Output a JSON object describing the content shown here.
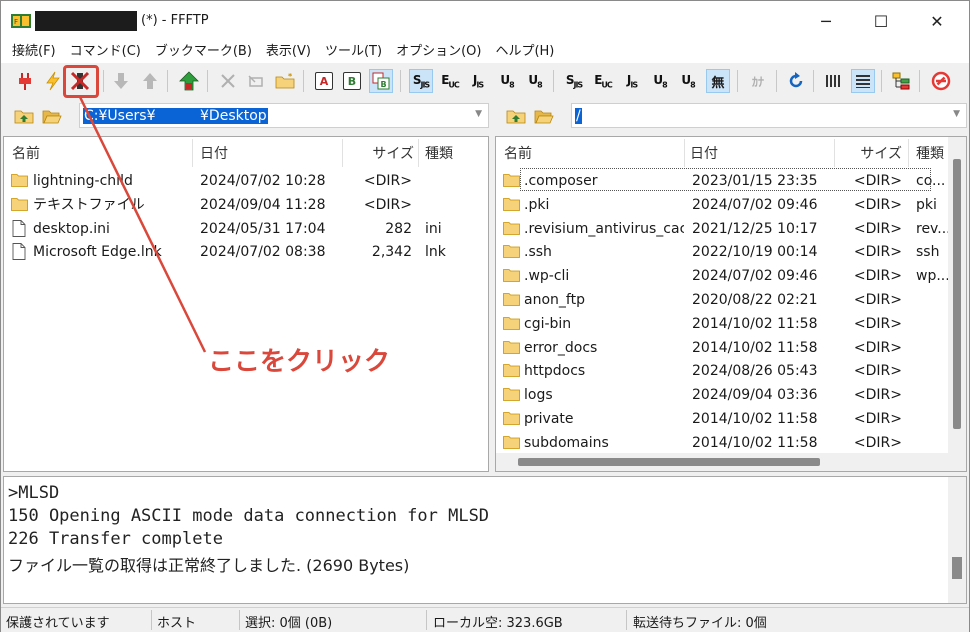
{
  "window": {
    "title": "(*) - FFFTP",
    "min_label": "─",
    "max_label": "☐",
    "close_label": "✕"
  },
  "menu": [
    "接続(F)",
    "コマンド(C)",
    "ブックマーク(B)",
    "表示(V)",
    "ツール(T)",
    "オプション(O)",
    "ヘルプ(H)"
  ],
  "toolbar": {
    "ascii_label": "A",
    "binary_label": "B",
    "kanji_sjis": "S",
    "kanji_euc": "E",
    "kanji_jis": "J",
    "kanji_utf8": "U",
    "kanji_utf8bom": "U",
    "no_convert": "無",
    "kana": "ｶﾅ"
  },
  "local": {
    "path": "C:¥Users¥          ¥Desktop",
    "columns": [
      "名前",
      "日付",
      "サイズ",
      "種類"
    ],
    "files": [
      {
        "name": "lightning-child",
        "date": "2024/07/02 10:28",
        "size": "<DIR>",
        "type": "",
        "folder": true
      },
      {
        "name": "テキストファイル",
        "date": "2024/09/04 11:28",
        "size": "<DIR>",
        "type": "",
        "folder": true
      },
      {
        "name": "desktop.ini",
        "date": "2024/05/31 17:04",
        "size": "282",
        "type": "ini",
        "folder": false
      },
      {
        "name": "Microsoft Edge.lnk",
        "date": "2024/07/02 08:38",
        "size": "2,342",
        "type": "lnk",
        "folder": false
      }
    ]
  },
  "remote": {
    "path": "/",
    "columns": [
      "名前",
      "日付",
      "サイズ",
      "種類"
    ],
    "files": [
      {
        "name": ".composer",
        "date": "2023/01/15 23:35",
        "size": "<DIR>",
        "type": "co..."
      },
      {
        "name": ".pki",
        "date": "2024/07/02 09:46",
        "size": "<DIR>",
        "type": "pki"
      },
      {
        "name": ".revisium_antivirus_cac...",
        "date": "2021/12/25 10:17",
        "size": "<DIR>",
        "type": "rev..."
      },
      {
        "name": ".ssh",
        "date": "2022/10/19 00:14",
        "size": "<DIR>",
        "type": "ssh"
      },
      {
        "name": ".wp-cli",
        "date": "2024/07/02 09:46",
        "size": "<DIR>",
        "type": "wp..."
      },
      {
        "name": "anon_ftp",
        "date": "2020/08/22 02:21",
        "size": "<DIR>",
        "type": ""
      },
      {
        "name": "cgi-bin",
        "date": "2014/10/02 11:58",
        "size": "<DIR>",
        "type": ""
      },
      {
        "name": "error_docs",
        "date": "2014/10/02 11:58",
        "size": "<DIR>",
        "type": ""
      },
      {
        "name": "httpdocs",
        "date": "2024/08/26 05:43",
        "size": "<DIR>",
        "type": ""
      },
      {
        "name": "logs",
        "date": "2024/09/04 03:36",
        "size": "<DIR>",
        "type": ""
      },
      {
        "name": "private",
        "date": "2014/10/02 11:58",
        "size": "<DIR>",
        "type": ""
      },
      {
        "name": "subdomains",
        "date": "2014/10/02 11:58",
        "size": "<DIR>",
        "type": ""
      }
    ]
  },
  "log": [
    ">MLSD",
    "150 Opening ASCII mode data connection for MLSD",
    "226 Transfer complete",
    "ファイル一覧の取得は正常終了しました. (2690 Bytes)"
  ],
  "status": {
    "security": "保護されています",
    "host": "ホスト",
    "selection": "選択: 0個 (0B)",
    "local_free": "ローカル空: 323.6GB",
    "queue": "転送待ちファイル: 0個"
  },
  "annotation": {
    "text": "ここをクリック",
    "color": "#d9483b"
  }
}
